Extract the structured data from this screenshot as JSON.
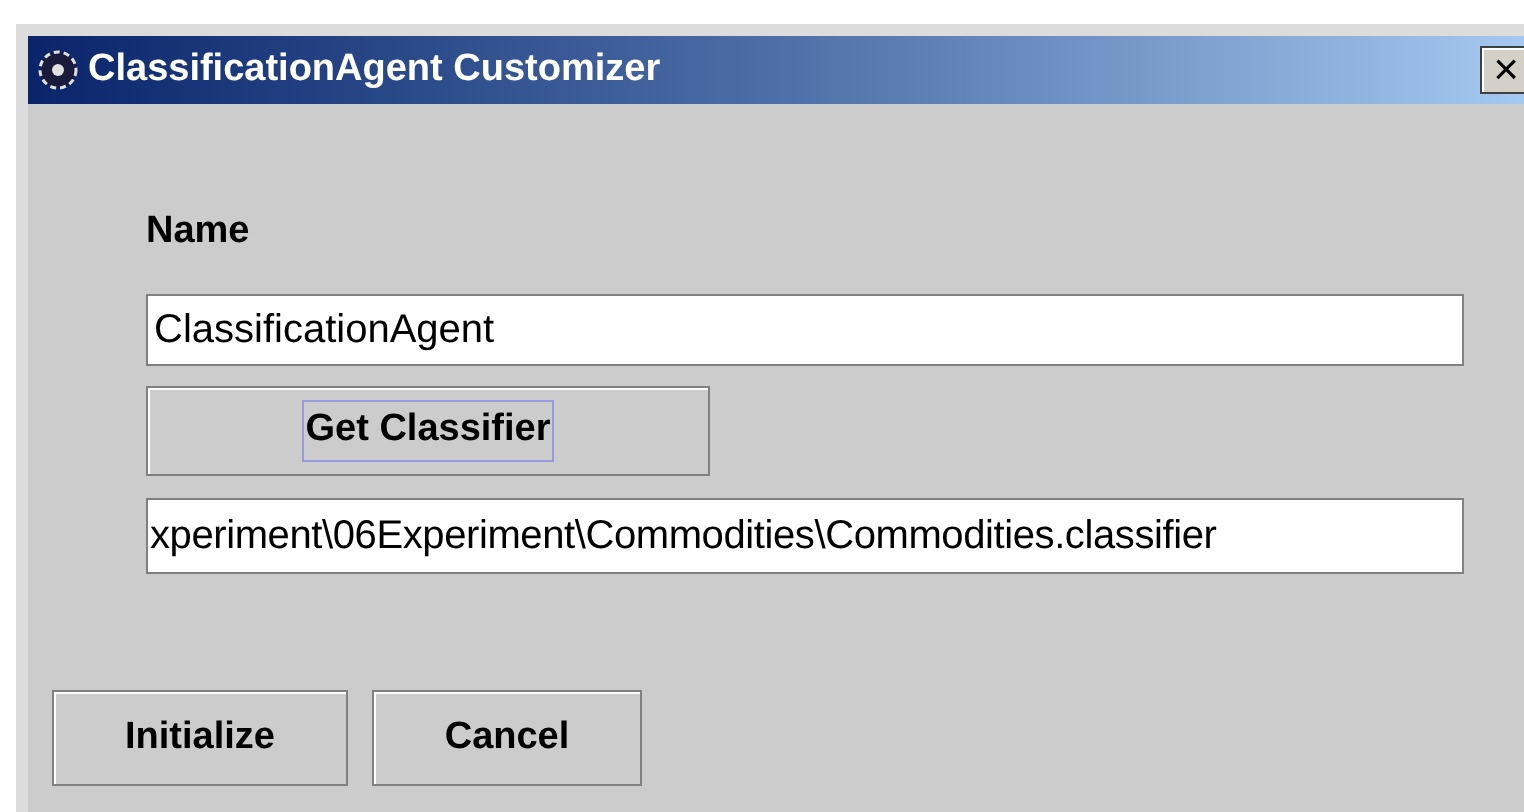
{
  "window": {
    "title": "ClassificationAgent Customizer",
    "close": "×"
  },
  "name_label": "Name",
  "name_field": {
    "value": "ClassificationAgent"
  },
  "get_classifier_button": {
    "label": "Get Classifier",
    "focused": true
  },
  "classifier_path_field": {
    "value": "xperiment\\06Experiment\\Commodities\\Commodities.classifier"
  },
  "buttons": [
    {
      "label": "Initialize"
    },
    {
      "label": "Cancel"
    }
  ]
}
